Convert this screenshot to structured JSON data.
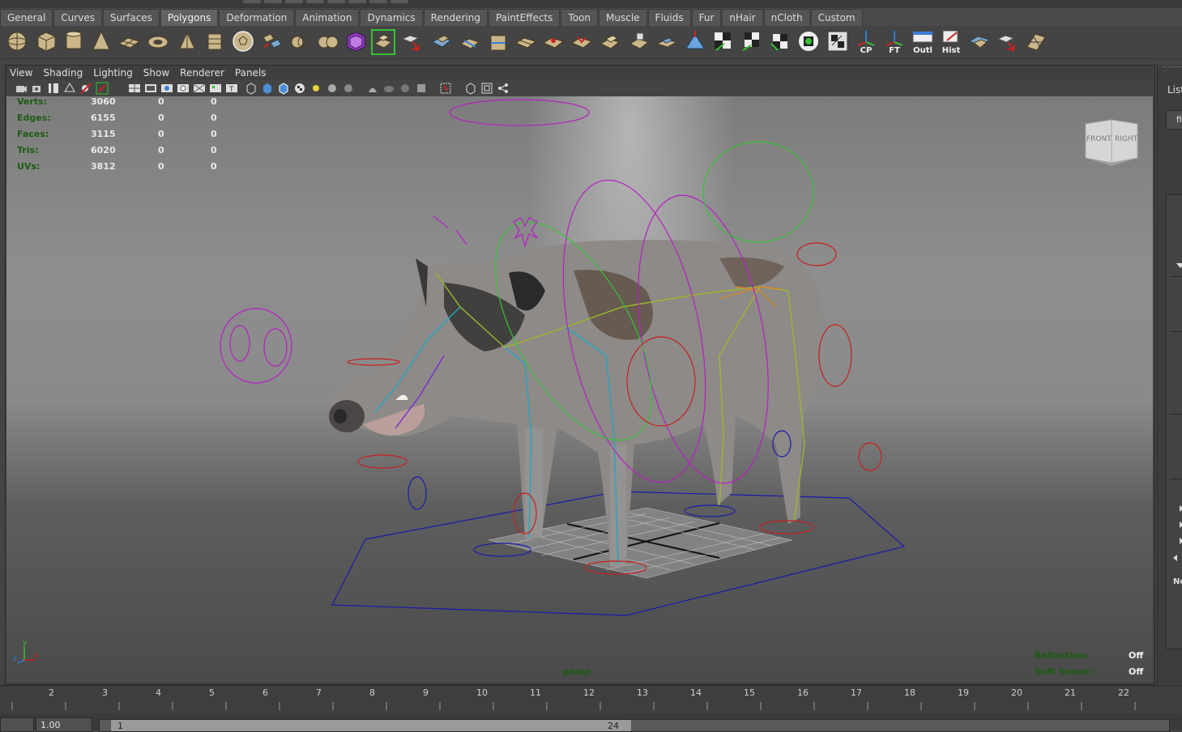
{
  "shelf": {
    "tabs": [
      "General",
      "Curves",
      "Surfaces",
      "Polygons",
      "Deformation",
      "Animation",
      "Dynamics",
      "Rendering",
      "PaintEffects",
      "Toon",
      "Muscle",
      "Fluids",
      "Fur",
      "nHair",
      "nCloth",
      "Custom"
    ],
    "active_tab": "Polygons",
    "icon_labels": {
      "cp": "CP",
      "ft": "FT",
      "outl": "Outl",
      "hist": "Hist"
    }
  },
  "panel_menu": [
    "View",
    "Shading",
    "Lighting",
    "Show",
    "Renderer",
    "Panels"
  ],
  "hud": {
    "rows": [
      {
        "label": "Verts:",
        "v1": "3060",
        "v2": "0",
        "v3": "0"
      },
      {
        "label": "Edges:",
        "v1": "6155",
        "v2": "0",
        "v3": "0"
      },
      {
        "label": "Faces:",
        "v1": "3115",
        "v2": "0",
        "v3": "0"
      },
      {
        "label": "Tris:",
        "v1": "6020",
        "v2": "0",
        "v3": "0"
      },
      {
        "label": "UVs:",
        "v1": "3812",
        "v2": "0",
        "v3": "0"
      }
    ],
    "camera": "persp",
    "reflection_label": "Reflection:",
    "reflection_value": "Off",
    "soft_select_label": "Soft Select:",
    "soft_select_value": "Off"
  },
  "viewcube": {
    "front": "FRONT",
    "right": "RIGHT"
  },
  "axis": {
    "y": "y",
    "x": "x",
    "z": "z"
  },
  "right_panel": {
    "list_label": "List",
    "field_text": "fil",
    "no_label": "No"
  },
  "timeline": {
    "ticks": [
      "2",
      "3",
      "4",
      "5",
      "6",
      "7",
      "8",
      "9",
      "10",
      "11",
      "12",
      "13",
      "14",
      "15",
      "16",
      "17",
      "18",
      "19",
      "20",
      "21",
      "22"
    ],
    "range_start": "1.00",
    "range_min": "1",
    "range_max": "24"
  },
  "colors": {
    "hud_green": "#1d5b12",
    "nurbs_magenta": "#b61fc3",
    "nurbs_blue": "#1a1aa8",
    "nurbs_red": "#c81e1e",
    "nurbs_green": "#35c235"
  }
}
